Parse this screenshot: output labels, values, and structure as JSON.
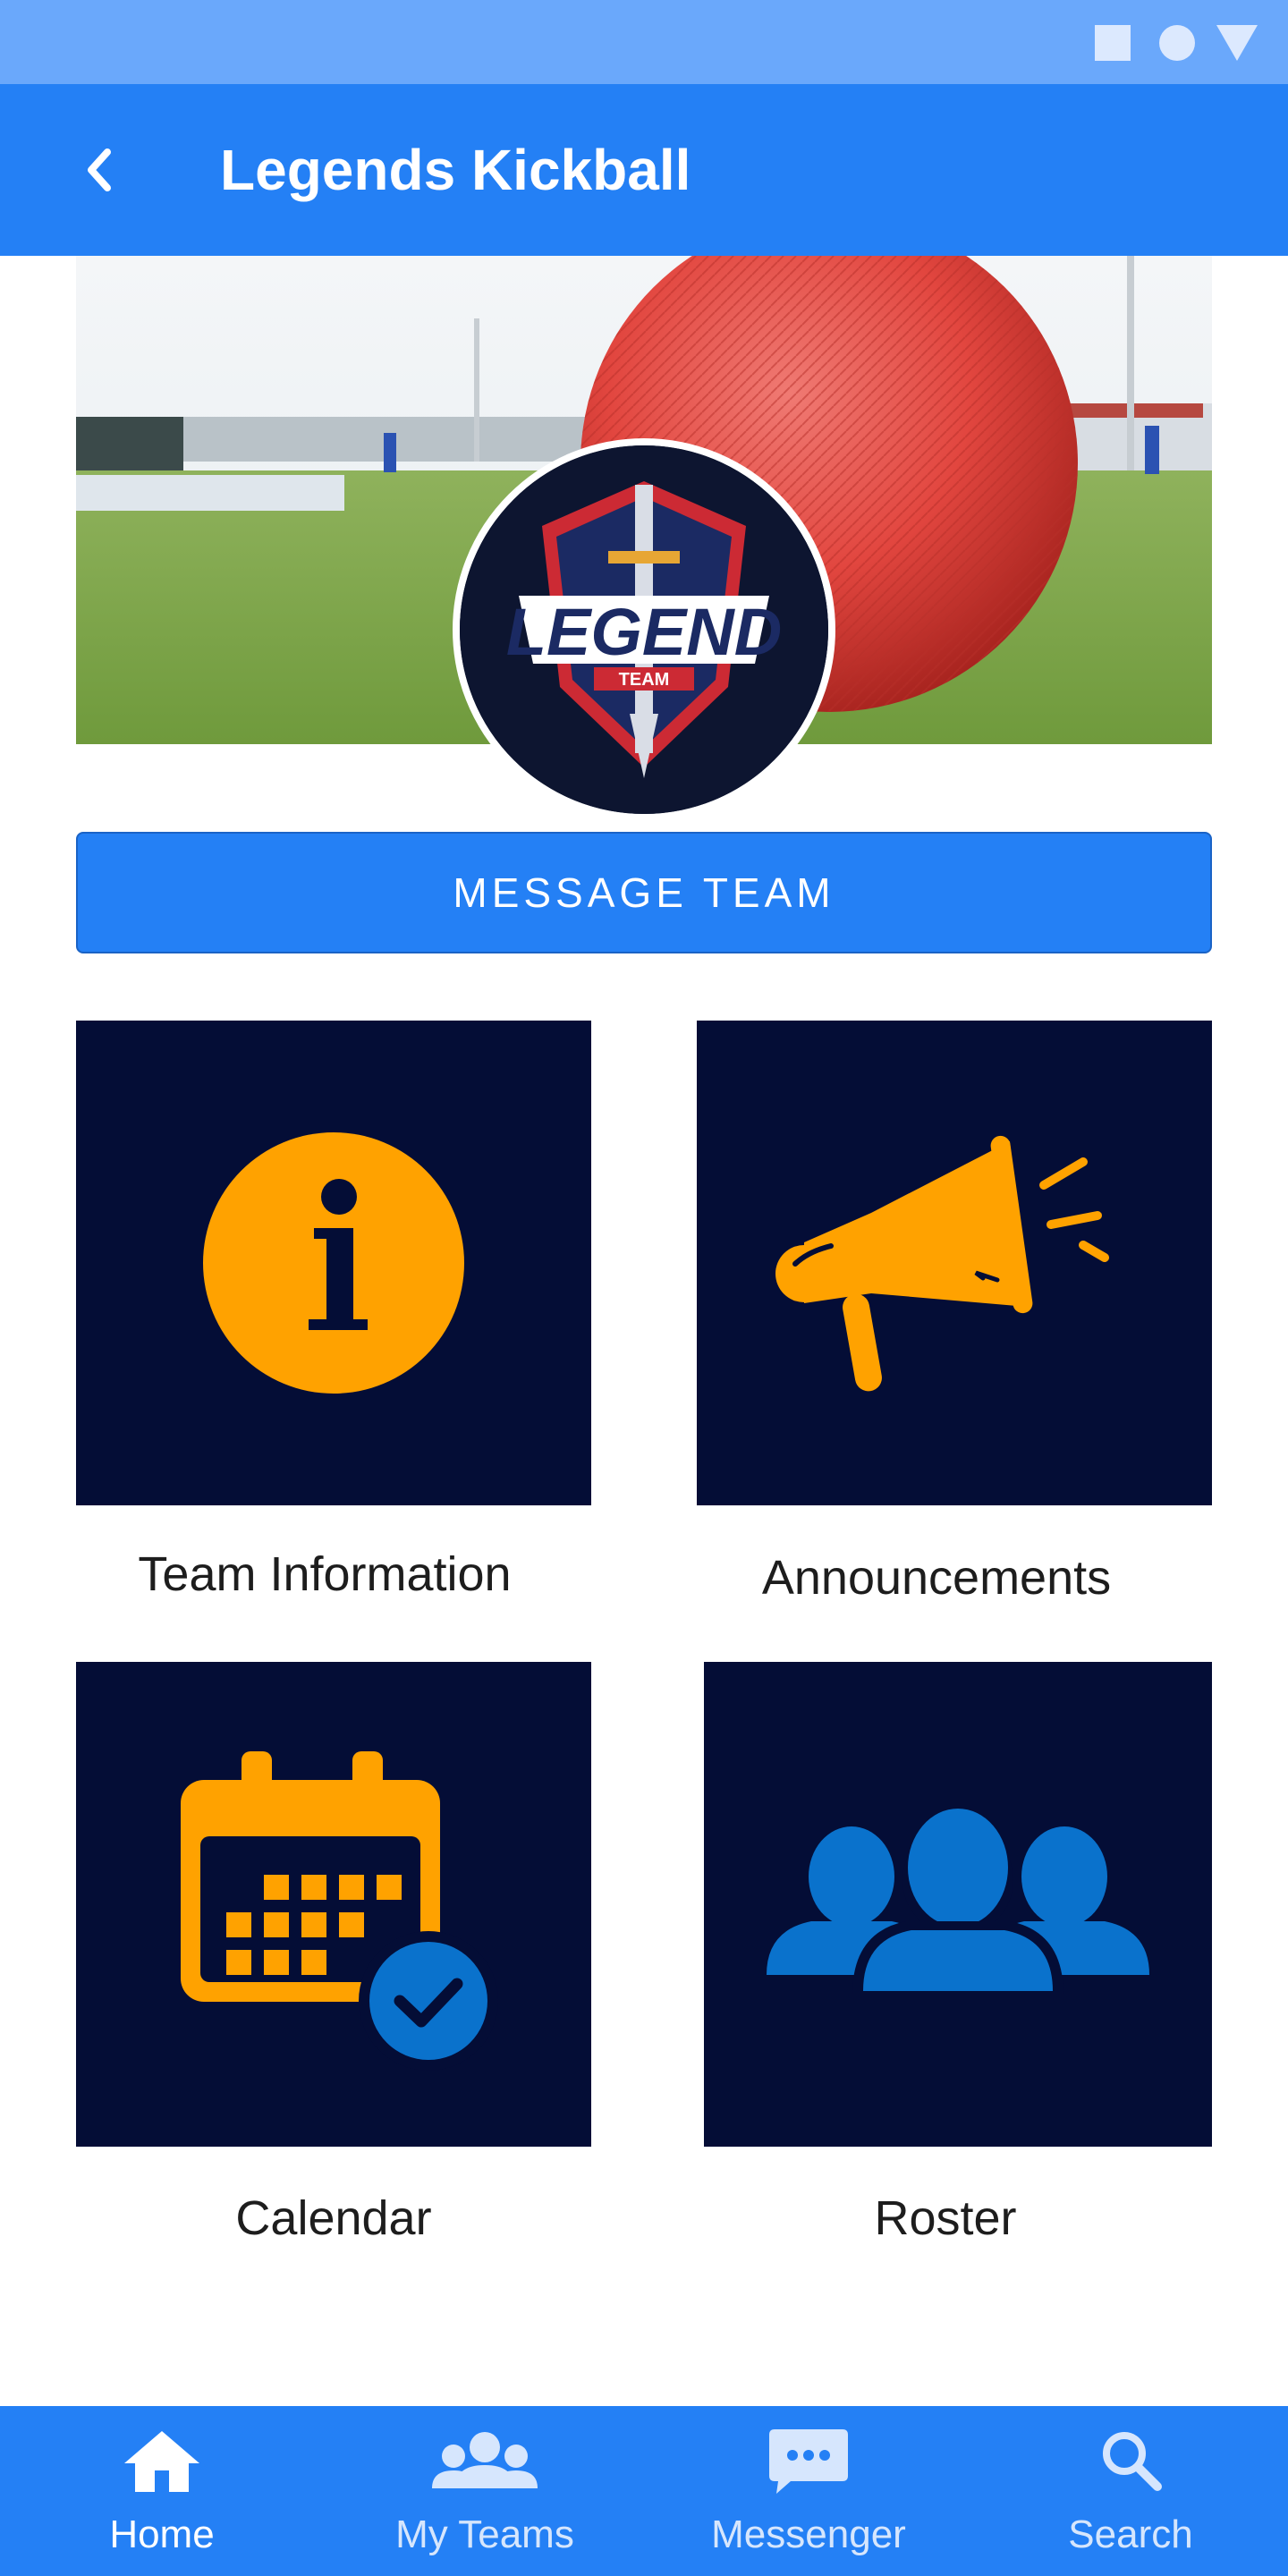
{
  "app_bar": {
    "title": "Legends Kickball"
  },
  "hero": {
    "logo_text": "LEGEND",
    "logo_subtext": "TEAM"
  },
  "actions": {
    "message_team": "MESSAGE TEAM"
  },
  "tiles": [
    {
      "label": "Team Information",
      "icon": "info-icon"
    },
    {
      "label": "Announcements",
      "icon": "megaphone-icon"
    },
    {
      "label": "Calendar",
      "icon": "calendar-check-icon"
    },
    {
      "label": "Roster",
      "icon": "group-icon"
    }
  ],
  "bottom_nav": {
    "items": [
      {
        "label": "Home",
        "icon": "home-icon",
        "active": true
      },
      {
        "label": "My Teams",
        "icon": "teams-icon",
        "active": false
      },
      {
        "label": "Messenger",
        "icon": "chat-icon",
        "active": false
      },
      {
        "label": "Search",
        "icon": "search-icon",
        "active": false
      }
    ]
  },
  "colors": {
    "status_bar": "#6aa8fb",
    "primary": "#2480f5",
    "tile_background": "#040d36",
    "accent_orange": "#ffa200",
    "accent_blue": "#0a72cc",
    "inactive_nav_label": "#d6e6fd"
  }
}
